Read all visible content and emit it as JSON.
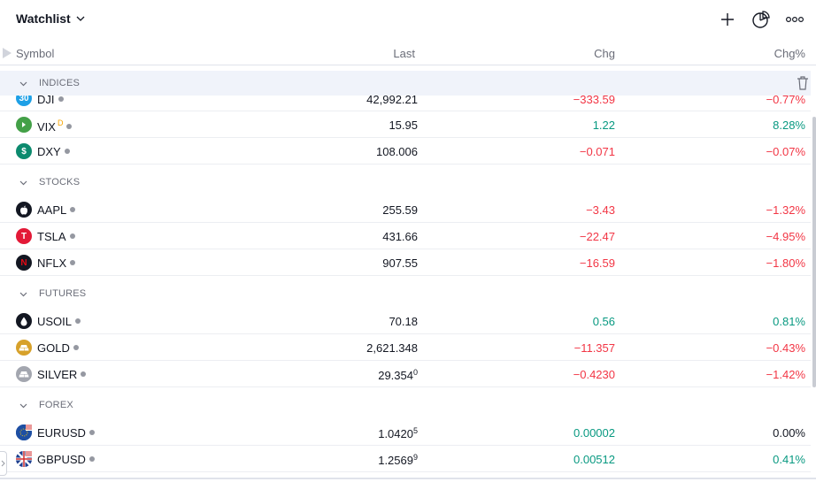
{
  "header": {
    "title": "Watchlist",
    "icons": [
      "add-icon",
      "chart-pie-icon",
      "more-icon"
    ]
  },
  "columns": {
    "symbol": "Symbol",
    "last": "Last",
    "chg": "Chg",
    "chgp": "Chg%"
  },
  "sections": [
    {
      "label": "INDICES"
    },
    {
      "label": "STOCKS"
    },
    {
      "label": "FUTURES"
    },
    {
      "label": "FOREX"
    }
  ],
  "rows": [
    {
      "symbol": "DJI",
      "last": "42,992.21",
      "chg": "−333.59",
      "chgp": "−0.77%",
      "dir": "neg",
      "logo_color": "#2962ff",
      "logo_text": "30"
    },
    {
      "symbol": "VIX",
      "tag": "D",
      "last": "15.95",
      "chg": "1.22",
      "chgp": "8.28%",
      "dir": "pos",
      "logo_color": "#4caf50",
      "logo_text": "▸"
    },
    {
      "symbol": "DXY",
      "last": "108.006",
      "chg": "−0.071",
      "chgp": "−0.07%",
      "dir": "neg",
      "logo_color": "#089981",
      "logo_text": "$"
    },
    {
      "symbol": "AAPL",
      "last": "255.59",
      "chg": "−3.43",
      "chgp": "−1.32%",
      "dir": "neg",
      "logo_color": "#131722",
      "logo_text": ""
    },
    {
      "symbol": "TSLA",
      "last": "431.66",
      "chg": "−22.47",
      "chgp": "−4.95%",
      "dir": "neg",
      "logo_color": "#e31937",
      "logo_text": "T"
    },
    {
      "symbol": "NFLX",
      "last": "907.55",
      "chg": "−16.59",
      "chgp": "−1.80%",
      "dir": "neg",
      "logo_color": "#131722",
      "logo_text": "N"
    },
    {
      "symbol": "USOIL",
      "last": "70.18",
      "chg": "0.56",
      "chgp": "0.81%",
      "dir": "pos",
      "logo_color": "#131722",
      "logo_text": ""
    },
    {
      "symbol": "GOLD",
      "last": "2,621.348",
      "chg": "−11.357",
      "chgp": "−0.43%",
      "dir": "neg",
      "logo_color": "#d7a12a",
      "logo_text": ""
    },
    {
      "symbol": "SILVER",
      "last_main": "29.354",
      "last_sup": "0",
      "chg": "−0.4230",
      "chgp": "−1.42%",
      "dir": "neg",
      "logo_color": "#9598a1",
      "logo_text": ""
    },
    {
      "symbol": "EURUSD",
      "last_main": "1.0420",
      "last_sup": "5",
      "chg": "0.00002",
      "chgp": "0.00%",
      "dir": "pos",
      "chgp_dir": "zero",
      "logo_color": "#1e4fa3",
      "logo_text": ""
    },
    {
      "symbol": "GBPUSD",
      "last_main": "1.2569",
      "last_sup": "9",
      "chg": "0.00512",
      "chgp": "0.41%",
      "dir": "pos",
      "logo_color": "#1e3f8f",
      "logo_text": ""
    }
  ],
  "colors": {
    "negative": "#f23645",
    "positive": "#089981",
    "section_highlight": "#f0f3fa"
  }
}
